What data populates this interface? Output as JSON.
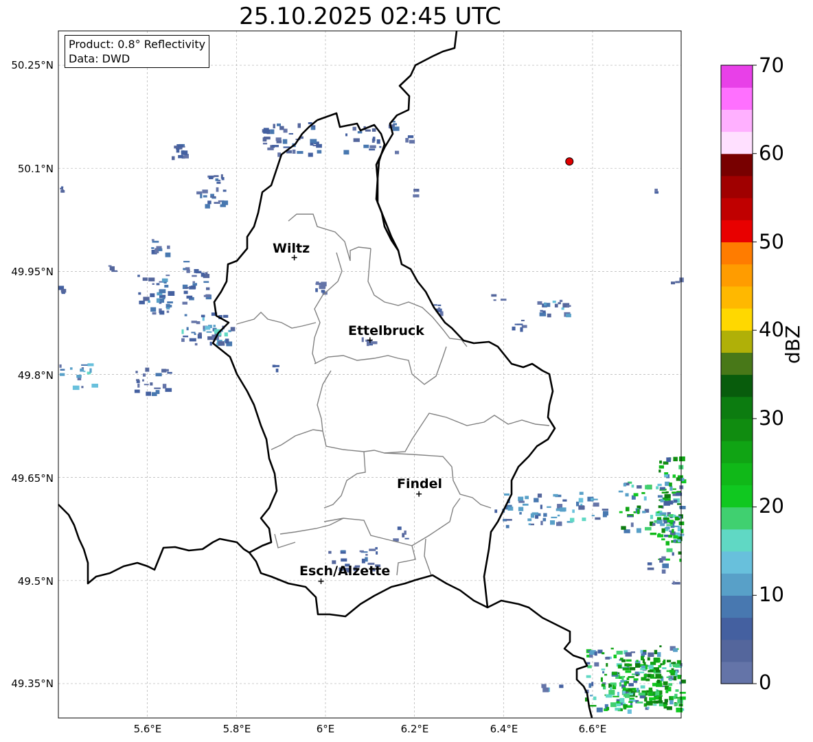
{
  "title": "25.10.2025 02:45 UTC",
  "info": {
    "product": "Product: 0.8° Reflectivity",
    "source": "Data: DWD"
  },
  "map": {
    "lon_range": [
      5.4,
      6.8
    ],
    "lat_range": [
      49.3,
      50.3
    ],
    "grid": true,
    "lat_ticks": [
      "50.25°N",
      "50.1°N",
      "49.95°N",
      "49.8°N",
      "49.65°N",
      "49.5°N",
      "49.35°N"
    ],
    "lon_ticks": [
      "5.6°E",
      "5.8°E",
      "6°E",
      "6.2°E",
      "6.4°E",
      "6.6°E"
    ],
    "cities": [
      {
        "name": "Wiltz",
        "lon": 5.93,
        "lat": 49.97
      },
      {
        "name": "Ettelbruck",
        "lon": 6.1,
        "lat": 49.85
      },
      {
        "name": "Findel",
        "lon": 6.21,
        "lat": 49.626
      },
      {
        "name": "Esch/Alzette",
        "lon": 5.99,
        "lat": 49.499
      }
    ],
    "radar_site": {
      "lon": 6.548,
      "lat": 50.11,
      "color": "#e00000"
    },
    "border_color": "#000000",
    "canton_color": "#808080"
  },
  "colorbar": {
    "label": "dBZ",
    "min": 0,
    "max": 70,
    "step": 2.5,
    "ticks": [
      "0",
      "10",
      "20",
      "30",
      "40",
      "50",
      "60",
      "70"
    ],
    "colors": [
      "#6474a8",
      "#54669c",
      "#4460a0",
      "#4878b0",
      "#58a0c8",
      "#68c0dc",
      "#60d8c4",
      "#40d070",
      "#10c820",
      "#10b818",
      "#10a414",
      "#108c10",
      "#0c7c10",
      "#085c0c",
      "#487818",
      "#b0b008",
      "#ffd800",
      "#ffb800",
      "#ff9c00",
      "#ff7c00",
      "#e80000",
      "#c00000",
      "#a00000",
      "#780000",
      "#ffe0ff",
      "#ffb0ff",
      "#ff70ff",
      "#e840e8"
    ]
  }
}
